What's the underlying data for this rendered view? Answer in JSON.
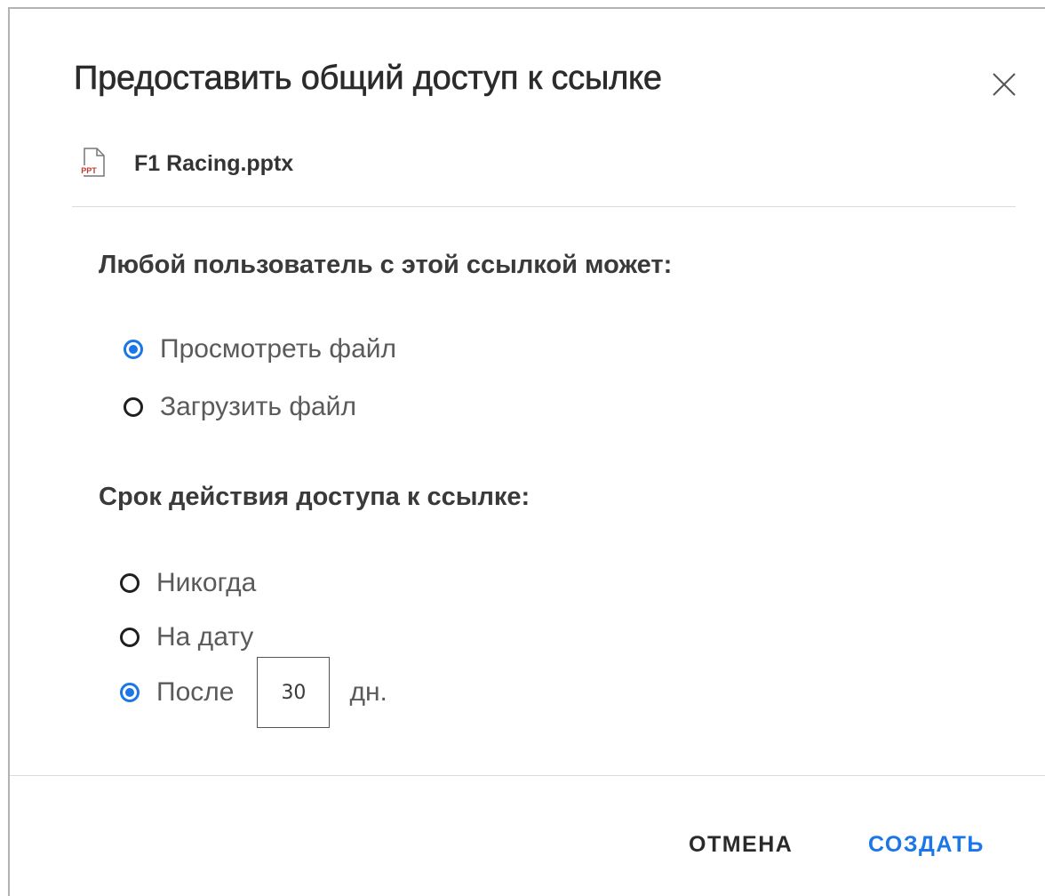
{
  "dialog": {
    "title": "Предоставить общий доступ к ссылке",
    "close_icon": "close-icon"
  },
  "file": {
    "icon": "pptx-file-icon",
    "icon_label": "PPT",
    "name": "F1 Racing.pptx"
  },
  "permissions": {
    "label": "Любой пользователь с этой ссылкой может:",
    "options": [
      {
        "label": "Просмотреть файл",
        "selected": true
      },
      {
        "label": "Загрузить файл",
        "selected": false
      }
    ]
  },
  "expiration": {
    "label": "Срок действия доступа к ссылке:",
    "options": [
      {
        "label": "Никогда",
        "selected": false
      },
      {
        "label": "На дату",
        "selected": false
      },
      {
        "label": "После",
        "selected": true
      }
    ],
    "days_value": "30",
    "days_unit": "дн."
  },
  "footer": {
    "cancel_label": "ОТМЕНА",
    "create_label": "СОЗДАТЬ"
  },
  "colors": {
    "accent": "#1b76e8",
    "file_icon_red": "#c0392b"
  }
}
